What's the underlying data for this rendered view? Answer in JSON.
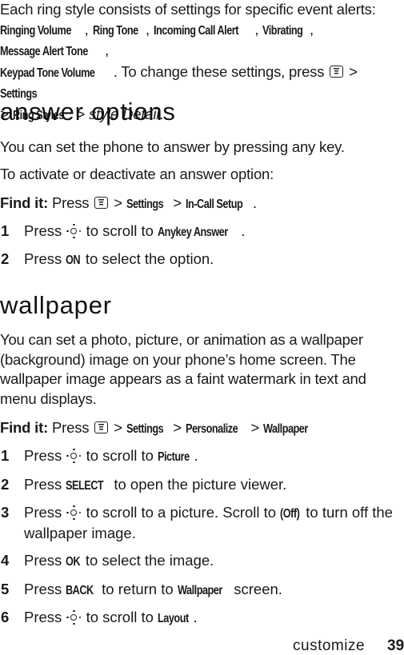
{
  "intro": {
    "text_1": "Each ring style consists of settings for specific event alerts:",
    "items": [
      "Ringing Volume",
      "Ring Tone",
      "Incoming Call Alert",
      "Vibrating",
      "Message Alert Tone",
      "Keypad Tone Volume"
    ],
    "text_2": ". To change these settings, press",
    "menu_1": "Settings",
    "menu_2": "Ring Styles",
    "italic": "style Detail",
    "sep": ">",
    "comma": ",",
    "period": "."
  },
  "answer_options": {
    "heading": "answer options",
    "p1": "You can set the phone to answer by pressing any key.",
    "p2": "To activate or deactivate an answer option:",
    "find_it": {
      "label": "Find it:",
      "press": "Press",
      "path": [
        "Settings",
        "In-Call Setup"
      ]
    },
    "steps": [
      {
        "num": "1",
        "pre": "Press",
        "mid": "to scroll to",
        "bold": "Anykey Answer",
        "post": "."
      },
      {
        "num": "2",
        "pre": "Press",
        "bold": "ON",
        "post": "to select the option."
      }
    ]
  },
  "wallpaper": {
    "heading": "wallpaper",
    "lines": [
      "You can set a photo, picture, or animation as a wallpaper",
      "(background) image on your phone’s home screen. The",
      "wallpaper image appears as a faint watermark in text and",
      "menu displays."
    ],
    "find_it": {
      "label": "Find it:",
      "press": "Press",
      "path": [
        "Settings",
        "Personalize",
        "Wallpaper"
      ]
    },
    "steps": [
      {
        "num": "1",
        "pre": "Press",
        "mid": "to scroll to",
        "bold": "Picture",
        "post": "."
      },
      {
        "num": "2",
        "pre": "Press",
        "bold": "SELECT",
        "post": "to open the picture viewer."
      },
      {
        "num": "3",
        "pre": "Press",
        "mid": "to scroll to a picture. Scroll to",
        "bold": "(Off)",
        "post": "to turn off the",
        "line2": "wallpaper image."
      },
      {
        "num": "4",
        "pre": "Press",
        "bold": "OK",
        "post": "to select the image."
      },
      {
        "num": "5",
        "pre": "Press",
        "bold": "BACK",
        "mid": "to return to",
        "bold2": "Wallpaper",
        "post": "screen."
      },
      {
        "num": "6",
        "pre": "Press",
        "mid": "to scroll to",
        "bold": "Layout",
        "post": "."
      }
    ]
  },
  "footer": {
    "section": "customize",
    "page": "39"
  }
}
